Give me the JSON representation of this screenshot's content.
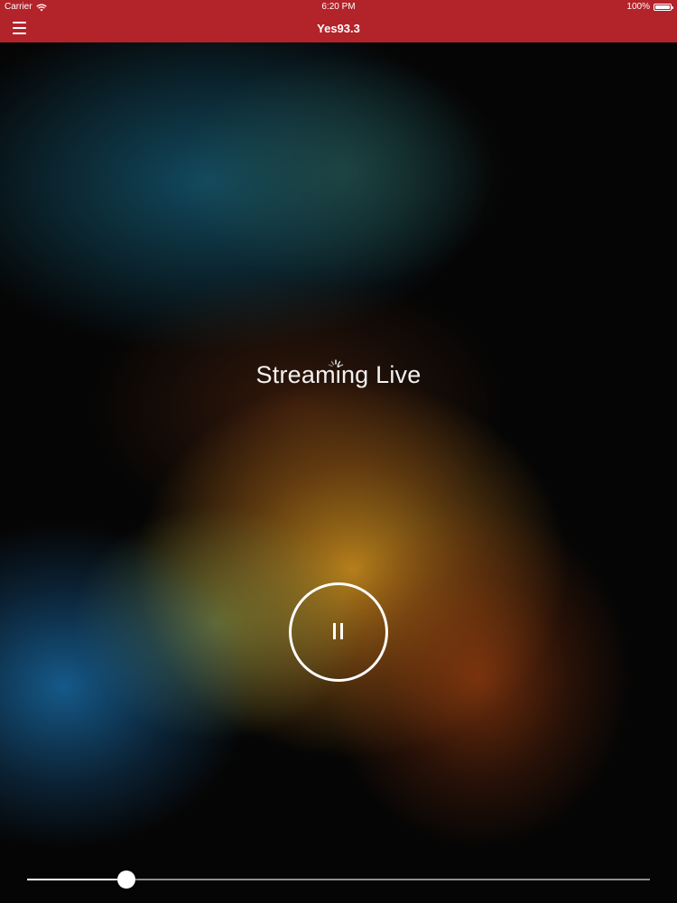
{
  "status_bar": {
    "carrier": "Carrier",
    "time": "6:20 PM",
    "battery": "100%",
    "battery_level": 1.0,
    "icons": [
      "wifi-icon",
      "battery-icon"
    ]
  },
  "nav": {
    "title": "Yes93.3",
    "menu_icon": "hamburger-menu-icon"
  },
  "player": {
    "status_text": "Streaming Live",
    "loading_icon": "spinner-icon",
    "control_icon": "pause-icon",
    "volume_level": 0.16
  },
  "colors": {
    "brand_red": "#b3232a",
    "foreground": "#ffffff"
  }
}
